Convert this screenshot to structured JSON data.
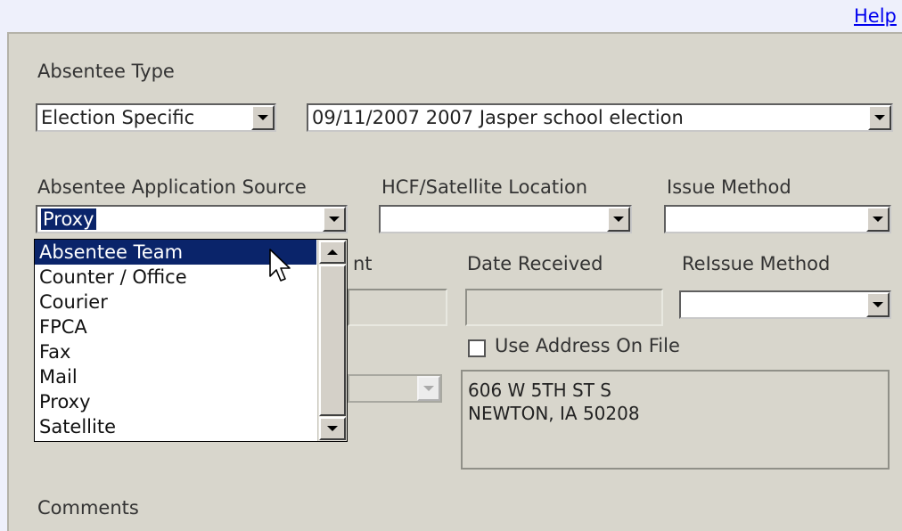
{
  "help_link": "Help",
  "absentee_type": {
    "label": "Absentee Type",
    "type_value": "Election Specific",
    "election_value": "09/11/2007 2007 Jasper school election"
  },
  "row2": {
    "source_label": "Absentee Application Source",
    "source_value": "Proxy",
    "hcf_label": "HCF/Satellite Location",
    "hcf_value": "",
    "issue_label": "Issue Method",
    "issue_value": ""
  },
  "row3": {
    "partial_label": "nt",
    "date_received_label": "Date Received",
    "reissue_label": "ReIssue Method",
    "reissue_value": ""
  },
  "use_address": {
    "label": "Use Address On File",
    "checked": false
  },
  "address": {
    "line1": "606 W 5TH ST S",
    "line2": "NEWTON, IA 50208"
  },
  "comments_label": "Comments",
  "source_dropdown": {
    "highlighted": "Absentee Team",
    "options": [
      "Absentee Team",
      "Counter / Office",
      "Courier",
      "FPCA",
      "Fax",
      "Mail",
      "Proxy",
      "Satellite"
    ]
  },
  "colors": {
    "panel_bg": "#d8d6cc",
    "page_bg": "#eef0fb",
    "selection": "#0a246a",
    "link": "#0000ee"
  }
}
